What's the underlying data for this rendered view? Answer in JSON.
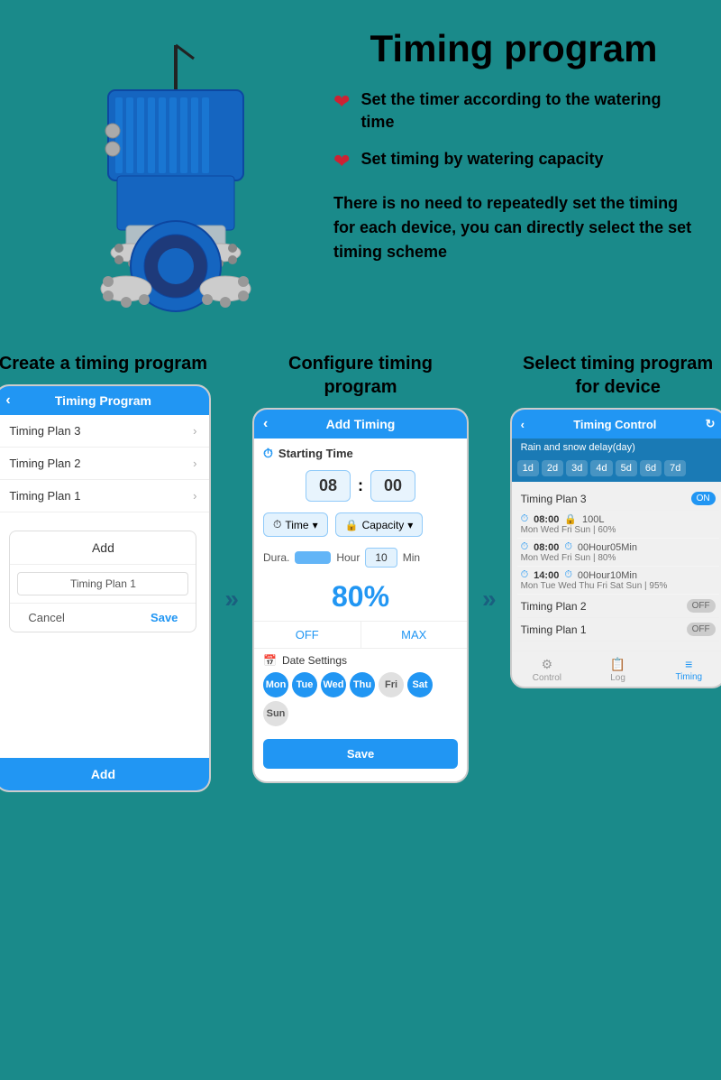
{
  "page": {
    "title": "Timing program",
    "background_color": "#1a8a8a"
  },
  "hero": {
    "bullets": [
      {
        "text": "Set the timer according to the watering time"
      },
      {
        "text": "Set timing by watering capacity"
      }
    ],
    "description": "There is no need to repeatedly set the timing for each device, you can directly select the set timing scheme"
  },
  "steps": [
    {
      "title": "Create a timing program",
      "phone": {
        "header": "Timing Program",
        "plans": [
          "Timing Plan 3",
          "Timing Plan 2",
          "Timing Plan 1"
        ],
        "dialog_title": "Add",
        "dialog_input": "Timing Plan 1",
        "btn_cancel": "Cancel",
        "btn_save": "Save",
        "footer_add": "Add"
      }
    },
    {
      "title": "Configure timing program",
      "phone": {
        "header": "Add Timing",
        "starting_time_label": "Starting Time",
        "hour": "08",
        "minute": "00",
        "selector1": "Time",
        "selector2": "Capacity",
        "dura_label": "Dura.",
        "hour_label": "Hour",
        "min_value": "10",
        "min_label": "Min",
        "percent": "80%",
        "off_label": "OFF",
        "max_label": "MAX",
        "date_settings": "Date Settings",
        "days": [
          {
            "label": "Mon",
            "active": true
          },
          {
            "label": "Tue",
            "active": true
          },
          {
            "label": "Wed",
            "active": true
          },
          {
            "label": "Thu",
            "active": true
          },
          {
            "label": "Fri",
            "active": false
          },
          {
            "label": "Sat",
            "active": true
          },
          {
            "label": "Sun",
            "active": false
          }
        ],
        "save_btn": "Save"
      }
    },
    {
      "title": "Select timing program for device",
      "phone": {
        "header": "Timing Control",
        "rain_delay": "Rain and snow delay(day)",
        "day_tabs": [
          "1d",
          "2d",
          "3d",
          "4d",
          "5d",
          "6d",
          "7d"
        ],
        "plans": [
          {
            "name": "Timing Plan 3",
            "enabled": true,
            "schedules": [
              {
                "time": "08:00",
                "cap": "100L",
                "days": "Mon Wed Fri Sun",
                "pct": "60%"
              },
              {
                "time": "08:00",
                "cap": "00Hour05Min",
                "days": "Mon Wed Fri Sun",
                "pct": "80%"
              },
              {
                "time": "14:00",
                "cap": "00Hour10Min",
                "days": "Mon Tue Wed Thu Fri Sat Sun",
                "pct": "95%"
              }
            ]
          },
          {
            "name": "Timing Plan 2",
            "enabled": false,
            "schedules": []
          },
          {
            "name": "Timing Plan 1",
            "enabled": false,
            "schedules": []
          }
        ],
        "footer_tabs": [
          "Control",
          "Log",
          "Timing"
        ]
      }
    }
  ],
  "icons": {
    "heart": "❤",
    "back_arrow": "‹",
    "forward_arrow": "›",
    "double_arrows": "»",
    "clock": "⏱",
    "calendar": "📅",
    "chevron_down": "▾",
    "lock": "🔒",
    "refresh": "↻",
    "control_icon": "⚙",
    "log_icon": "📋",
    "timing_icon": "≡"
  }
}
